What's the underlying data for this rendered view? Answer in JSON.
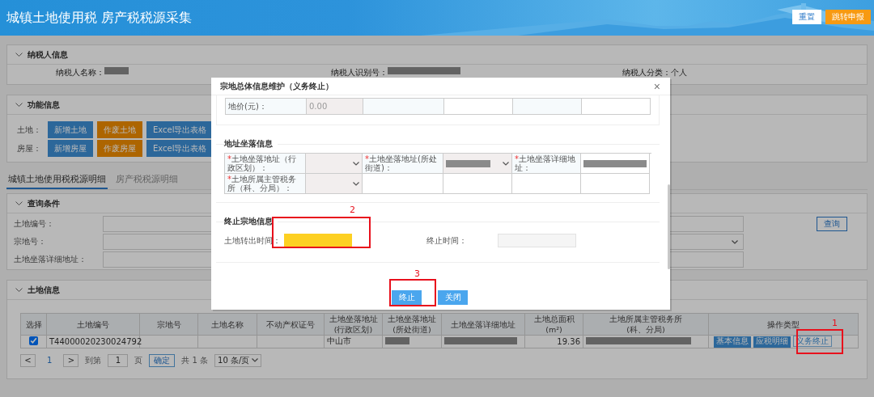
{
  "header": {
    "title": "城镇土地使用税 房产税税源采集",
    "buttons": [
      {
        "label": "重置",
        "kind": "secondary"
      },
      {
        "label": "跳转申报",
        "kind": "primary"
      }
    ]
  },
  "taxpayer_panel": {
    "title": "纳税人信息",
    "fields": [
      {
        "label": "纳税人名称：",
        "redacted": true
      },
      {
        "label": "纳税人识别号：",
        "redacted": true
      },
      {
        "label": "纳税人分类：",
        "value": "个人",
        "redacted": false
      }
    ]
  },
  "function_panel": {
    "title": "功能信息",
    "rows": [
      {
        "label": "土地：",
        "buttons": [
          {
            "label": "新增土地",
            "kind": "primary"
          },
          {
            "label": "作废土地",
            "kind": "warning"
          },
          {
            "label": "Excel导出表格",
            "kind": "primary"
          }
        ]
      },
      {
        "label": "房屋：",
        "buttons": [
          {
            "label": "新增房屋",
            "kind": "primary"
          },
          {
            "label": "作废房屋",
            "kind": "warning"
          },
          {
            "label": "Excel导出表格",
            "kind": "primary"
          }
        ]
      }
    ]
  },
  "tabs": [
    {
      "label": "城镇土地使用税税源明细",
      "selected": true
    },
    {
      "label": "房产税税源明细",
      "selected": false
    }
  ],
  "query_panel": {
    "title": "查询条件",
    "fields": [
      {
        "label": "土地编号：",
        "kind": "input"
      },
      {
        "label": "宗地号：",
        "kind": "select"
      },
      {
        "label": "土地坐落详细地址：",
        "kind": "input"
      }
    ],
    "button": "查询"
  },
  "land_panel": {
    "title": "土地信息",
    "table": {
      "columns": [
        {
          "lines": [
            "选择"
          ]
        },
        {
          "lines": [
            "土地编号"
          ]
        },
        {
          "lines": [
            "宗地号"
          ]
        },
        {
          "lines": [
            "土地名称"
          ]
        },
        {
          "lines": [
            "不动产权证号"
          ]
        },
        {
          "lines": [
            "土地坐落地址",
            "(行政区划)"
          ]
        },
        {
          "lines": [
            "土地坐落地址",
            "(所处街道)"
          ]
        },
        {
          "lines": [
            "土地坐落详细地址"
          ]
        },
        {
          "lines": [
            "土地总面积(m²)"
          ]
        },
        {
          "lines": [
            "土地所属主管税务所",
            "(科、分局)"
          ]
        },
        {
          "lines": [
            "操作类型"
          ]
        }
      ],
      "rows": [
        {
          "checked": true,
          "cells": [
            {
              "kind": "checkbox"
            },
            {
              "kind": "text",
              "text": "T44000020230024792"
            },
            {
              "kind": "text",
              "text": ""
            },
            {
              "kind": "text",
              "text": ""
            },
            {
              "kind": "text",
              "text": ""
            },
            {
              "kind": "text",
              "text": "中山市"
            },
            {
              "kind": "redacted"
            },
            {
              "kind": "redacted"
            },
            {
              "kind": "number",
              "text": "19.36"
            },
            {
              "kind": "redacted"
            },
            {
              "kind": "actions",
              "buttons": [
                {
                  "label": "基本信息",
                  "kind": "primary"
                },
                {
                  "label": "应税明细",
                  "kind": "primary"
                },
                {
                  "label": "义务终止",
                  "kind": "outline"
                }
              ]
            }
          ]
        }
      ]
    },
    "pagination": {
      "prev": "<",
      "page": "1",
      "next": ">",
      "goto_label": "到第",
      "goto_value": "1",
      "page_unit": "页",
      "confirm": "确定",
      "total": "共 1 条",
      "page_size": "10 条/页"
    }
  },
  "dialog": {
    "title": "宗地总体信息维护（义务终止）",
    "close": "×",
    "price_row": [
      {
        "kind": "label",
        "text": "地价(元)："
      },
      {
        "kind": "value",
        "text": "0.00",
        "disabled": true
      },
      {
        "kind": "labelblank"
      },
      {
        "kind": "blank"
      },
      {
        "kind": "labelblank"
      },
      {
        "kind": "blank"
      }
    ],
    "address_section": {
      "title": "地址坐落信息",
      "rows": [
        [
          {
            "kind": "label",
            "mark": "*",
            "text": "土地坐落地址（行政区划）："
          },
          {
            "kind": "select",
            "redacted": false
          },
          {
            "kind": "label",
            "mark": "*",
            "text": "土地坐落地址(所处街道)："
          },
          {
            "kind": "select",
            "redacted": true
          },
          {
            "kind": "label",
            "mark": "*",
            "text": "土地坐落详细地址："
          },
          {
            "kind": "value",
            "text": "",
            "redacted": true
          }
        ],
        [
          {
            "kind": "label",
            "mark": "*",
            "text": "土地所属主管税务所（科、分局）："
          },
          {
            "kind": "select",
            "redacted": false
          },
          {
            "kind": "blank"
          },
          {
            "kind": "blank"
          },
          {
            "kind": "blank"
          },
          {
            "kind": "blank"
          }
        ]
      ]
    },
    "end_section": {
      "title": "终止宗地信息",
      "fields": [
        {
          "label": "土地转出时间：",
          "highlighted": true,
          "disabled": false
        },
        {
          "label": "终止时间：",
          "highlighted": false,
          "disabled": true
        }
      ]
    },
    "buttons": [
      {
        "label": "终止"
      },
      {
        "label": "关闭"
      }
    ]
  },
  "annotations": [
    {
      "label": "2"
    },
    {
      "label": "3"
    },
    {
      "label": "1"
    }
  ]
}
